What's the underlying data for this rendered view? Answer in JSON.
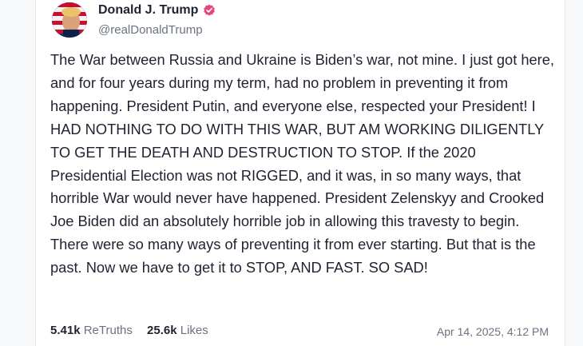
{
  "post": {
    "author_name": "Donald J. Trump",
    "author_handle": "@realDonaldTrump",
    "verified_icon": "verified-badge-icon",
    "text": "The War between Russia and Ukraine is Biden’s war, not mine. I just got here, and for four years during my term, had no problem in preventing it from happening. President Putin, and everyone else, respected your President! I HAD NOTHING TO DO WITH THIS WAR, BUT AM WORKING DILIGENTLY TO GET THE DEATH AND DESTRUCTION TO STOP. If the 2020 Presidential Election was not RIGGED, and it was, in so many ways, that horrible War would never have happened. President Zelenskyy and Crooked Joe Biden did an absolutely horrible job in allowing this travesty to begin. There were so many ways of preventing it from ever starting. But that is the past. Now we have to get it to STOP, AND FAST. SO SAD!",
    "retruths_count": "5.41k",
    "retruths_label": "ReTruths",
    "likes_count": "25.6k",
    "likes_label": "Likes",
    "timestamp": "Apr 14, 2025, 4:12 PM"
  },
  "colors": {
    "text_primary": "#1f2230",
    "text_secondary": "#6b7280",
    "verified_badge": "#e6447f",
    "card_background": "#ffffff"
  }
}
